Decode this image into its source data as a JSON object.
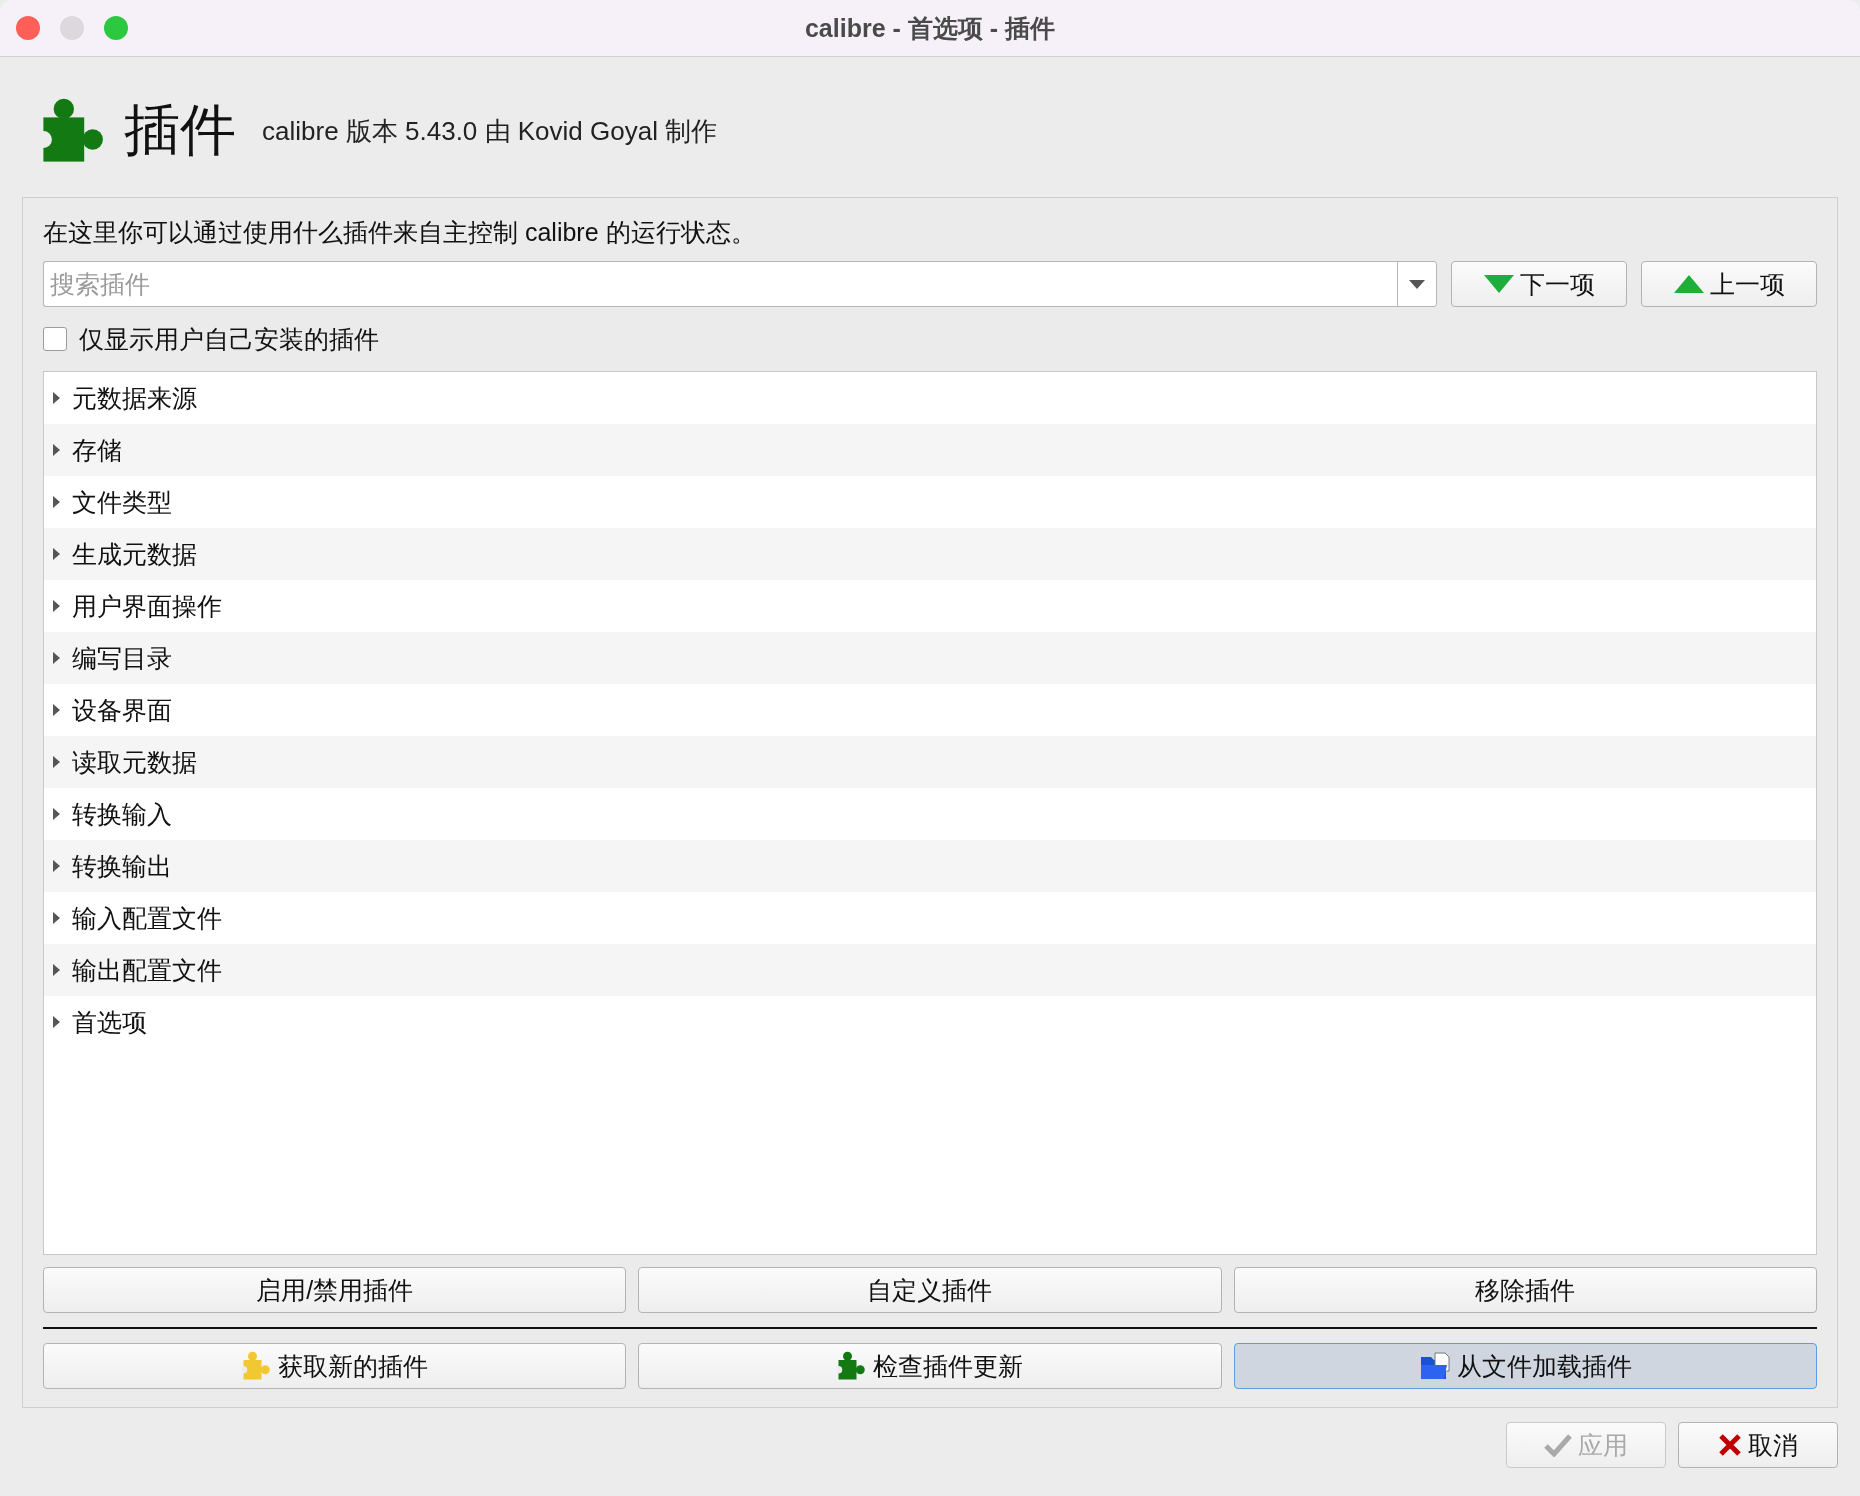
{
  "window": {
    "title": "calibre - 首选项 - 插件"
  },
  "header": {
    "title": "插件",
    "subtitle": "calibre 版本 5.43.0 由 Kovid Goyal 制作"
  },
  "description": "在这里你可以通过使用什么插件来自主控制 calibre 的运行状态。",
  "search": {
    "placeholder": "搜索插件"
  },
  "nav_buttons": [
    {
      "label": "下一项",
      "kind": "down"
    },
    {
      "label": "上一项",
      "kind": "up"
    }
  ],
  "filter_checkbox": {
    "label": "仅显示用户自己安装的插件",
    "checked": false
  },
  "categories": [
    {
      "label": "元数据来源",
      "expanded": false
    },
    {
      "label": "存储",
      "expanded": false
    },
    {
      "label": "文件类型",
      "expanded": false
    },
    {
      "label": "生成元数据",
      "expanded": false
    },
    {
      "label": "用户界面操作",
      "expanded": false
    },
    {
      "label": "编写目录",
      "expanded": false
    },
    {
      "label": "设备界面",
      "expanded": false
    },
    {
      "label": "读取元数据",
      "expanded": false
    },
    {
      "label": "转换输入",
      "expanded": false
    },
    {
      "label": "转换输出",
      "expanded": false
    },
    {
      "label": "输入配置文件",
      "expanded": false
    },
    {
      "label": "输出配置文件",
      "expanded": false
    },
    {
      "label": "首选项",
      "expanded": false
    }
  ],
  "plugin_buttons": [
    {
      "label": "启用/禁用插件"
    },
    {
      "label": "自定义插件"
    },
    {
      "label": "移除插件"
    }
  ],
  "action_buttons": [
    {
      "label": "获取新的插件",
      "kind": "get",
      "focused": false
    },
    {
      "label": "检查插件更新",
      "kind": "update",
      "focused": false
    },
    {
      "label": "从文件加载插件",
      "kind": "load",
      "focused": true
    }
  ],
  "dialog_buttons": [
    {
      "label": "应用",
      "kind": "apply",
      "disabled": true
    },
    {
      "label": "取消",
      "kind": "cancel",
      "disabled": false
    }
  ]
}
